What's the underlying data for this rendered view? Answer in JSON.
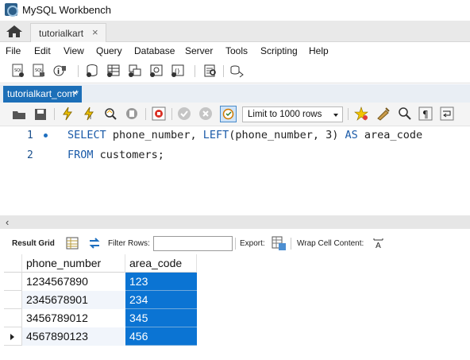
{
  "window": {
    "title": "MySQL Workbench"
  },
  "connection_tab": {
    "label": "tutorialkart",
    "close": "×"
  },
  "menu": [
    "File",
    "Edit",
    "View",
    "Query",
    "Database",
    "Server",
    "Tools",
    "Scripting",
    "Help"
  ],
  "query_tab": {
    "label": "tutorialkart_com*",
    "close": "×"
  },
  "sql_toolbar": {
    "limit_value": "Limit to 1000 rows"
  },
  "editor": {
    "lines": [
      {
        "number": "1",
        "keyword1": "SELECT",
        "text1": " phone_number, ",
        "keyword2": "LEFT",
        "text2": "(phone_number, 3) ",
        "keyword3": "AS",
        "text3": " area_code"
      },
      {
        "number": "2",
        "keyword1": "FROM",
        "text1": " customers;"
      }
    ]
  },
  "result_bar": {
    "result_grid_label": "Result Grid",
    "filter_rows_label": "Filter Rows:",
    "filter_value": "",
    "export_label": "Export:",
    "wrap_label": "Wrap Cell Content:"
  },
  "grid": {
    "columns": [
      "phone_number",
      "area_code"
    ],
    "rows": [
      [
        "1234567890",
        "123"
      ],
      [
        "2345678901",
        "234"
      ],
      [
        "3456789012",
        "345"
      ],
      [
        "4567890123",
        "456"
      ]
    ],
    "current_row_index": 3
  },
  "colors": {
    "selection": "#0b74d3",
    "query_tab": "#1c6fb8",
    "keyword": "#1a5aa8"
  }
}
